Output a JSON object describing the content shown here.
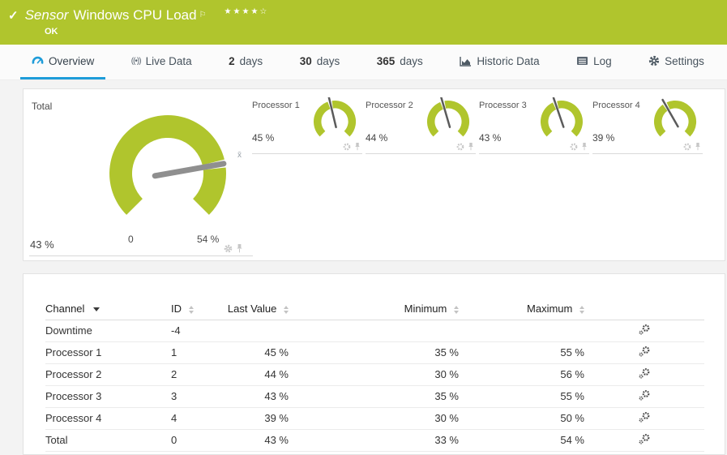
{
  "header": {
    "title_prefix": "Sensor",
    "title": "Windows CPU Load",
    "status": "OK",
    "stars": "★★★★☆",
    "flag": "⚐",
    "check": "✓"
  },
  "tabs": [
    {
      "num": "",
      "text": "Overview",
      "icon": "gauge-icon",
      "active": true
    },
    {
      "num": "",
      "text": "Live Data",
      "icon": "live-data-icon"
    },
    {
      "num": "2",
      "text": "days"
    },
    {
      "num": "30",
      "text": "days"
    },
    {
      "num": "365",
      "text": "days"
    },
    {
      "num": "",
      "text": "Historic Data",
      "icon": "historic-data-icon"
    },
    {
      "num": "",
      "text": "Log",
      "icon": "log-icon"
    },
    {
      "num": "",
      "text": "Settings",
      "icon": "gear-icon"
    }
  ],
  "gauges": {
    "total": {
      "label": "Total",
      "value": 43,
      "scale_min": 0,
      "scale_max": 54,
      "value_label": "43 %",
      "min_label": "0",
      "max_label": "54 %",
      "avg_marker": "x̄"
    },
    "processors": [
      {
        "label": "Processor 1",
        "value": 45,
        "value_label": "45 %"
      },
      {
        "label": "Processor 2",
        "value": 44,
        "value_label": "44 %"
      },
      {
        "label": "Processor 3",
        "value": 43,
        "value_label": "43 %"
      },
      {
        "label": "Processor 4",
        "value": 39,
        "value_label": "39 %"
      }
    ]
  },
  "table": {
    "columns": {
      "channel": "Channel",
      "id": "ID",
      "last": "Last Value",
      "min": "Minimum",
      "max": "Maximum"
    },
    "rows": [
      {
        "channel": "Downtime",
        "id": "-4",
        "last": "",
        "min": "",
        "max": ""
      },
      {
        "channel": "Processor 1",
        "id": "1",
        "last": "45 %",
        "min": "35 %",
        "max": "55 %"
      },
      {
        "channel": "Processor 2",
        "id": "2",
        "last": "44 %",
        "min": "30 %",
        "max": "56 %"
      },
      {
        "channel": "Processor 3",
        "id": "3",
        "last": "43 %",
        "min": "35 %",
        "max": "55 %"
      },
      {
        "channel": "Processor 4",
        "id": "4",
        "last": "39 %",
        "min": "30 %",
        "max": "50 %"
      },
      {
        "channel": "Total",
        "id": "0",
        "last": "43 %",
        "min": "33 %",
        "max": "54 %"
      }
    ]
  },
  "colors": {
    "green": "#b0c52d",
    "accent_blue": "#1e9cd9",
    "needle_gray": "#8f8f8f",
    "needle_dark": "#5b5b5b",
    "icon_light": "#c7c7c7",
    "icon_dark": "#444444"
  }
}
